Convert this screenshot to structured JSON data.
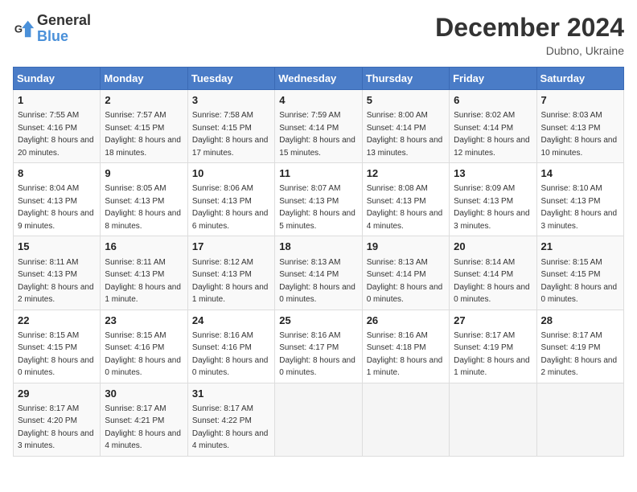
{
  "header": {
    "logo_general": "General",
    "logo_blue": "Blue",
    "month_title": "December 2024",
    "location": "Dubno, Ukraine"
  },
  "calendar": {
    "days_of_week": [
      "Sunday",
      "Monday",
      "Tuesday",
      "Wednesday",
      "Thursday",
      "Friday",
      "Saturday"
    ],
    "weeks": [
      [
        {
          "day": "1",
          "sunrise": "7:55 AM",
          "sunset": "4:16 PM",
          "daylight": "8 hours and 20 minutes."
        },
        {
          "day": "2",
          "sunrise": "7:57 AM",
          "sunset": "4:15 PM",
          "daylight": "8 hours and 18 minutes."
        },
        {
          "day": "3",
          "sunrise": "7:58 AM",
          "sunset": "4:15 PM",
          "daylight": "8 hours and 17 minutes."
        },
        {
          "day": "4",
          "sunrise": "7:59 AM",
          "sunset": "4:14 PM",
          "daylight": "8 hours and 15 minutes."
        },
        {
          "day": "5",
          "sunrise": "8:00 AM",
          "sunset": "4:14 PM",
          "daylight": "8 hours and 13 minutes."
        },
        {
          "day": "6",
          "sunrise": "8:02 AM",
          "sunset": "4:14 PM",
          "daylight": "8 hours and 12 minutes."
        },
        {
          "day": "7",
          "sunrise": "8:03 AM",
          "sunset": "4:13 PM",
          "daylight": "8 hours and 10 minutes."
        }
      ],
      [
        {
          "day": "8",
          "sunrise": "8:04 AM",
          "sunset": "4:13 PM",
          "daylight": "8 hours and 9 minutes."
        },
        {
          "day": "9",
          "sunrise": "8:05 AM",
          "sunset": "4:13 PM",
          "daylight": "8 hours and 8 minutes."
        },
        {
          "day": "10",
          "sunrise": "8:06 AM",
          "sunset": "4:13 PM",
          "daylight": "8 hours and 6 minutes."
        },
        {
          "day": "11",
          "sunrise": "8:07 AM",
          "sunset": "4:13 PM",
          "daylight": "8 hours and 5 minutes."
        },
        {
          "day": "12",
          "sunrise": "8:08 AM",
          "sunset": "4:13 PM",
          "daylight": "8 hours and 4 minutes."
        },
        {
          "day": "13",
          "sunrise": "8:09 AM",
          "sunset": "4:13 PM",
          "daylight": "8 hours and 3 minutes."
        },
        {
          "day": "14",
          "sunrise": "8:10 AM",
          "sunset": "4:13 PM",
          "daylight": "8 hours and 3 minutes."
        }
      ],
      [
        {
          "day": "15",
          "sunrise": "8:11 AM",
          "sunset": "4:13 PM",
          "daylight": "8 hours and 2 minutes."
        },
        {
          "day": "16",
          "sunrise": "8:11 AM",
          "sunset": "4:13 PM",
          "daylight": "8 hours and 1 minute."
        },
        {
          "day": "17",
          "sunrise": "8:12 AM",
          "sunset": "4:13 PM",
          "daylight": "8 hours and 1 minute."
        },
        {
          "day": "18",
          "sunrise": "8:13 AM",
          "sunset": "4:14 PM",
          "daylight": "8 hours and 0 minutes."
        },
        {
          "day": "19",
          "sunrise": "8:13 AM",
          "sunset": "4:14 PM",
          "daylight": "8 hours and 0 minutes."
        },
        {
          "day": "20",
          "sunrise": "8:14 AM",
          "sunset": "4:14 PM",
          "daylight": "8 hours and 0 minutes."
        },
        {
          "day": "21",
          "sunrise": "8:15 AM",
          "sunset": "4:15 PM",
          "daylight": "8 hours and 0 minutes."
        }
      ],
      [
        {
          "day": "22",
          "sunrise": "8:15 AM",
          "sunset": "4:15 PM",
          "daylight": "8 hours and 0 minutes."
        },
        {
          "day": "23",
          "sunrise": "8:15 AM",
          "sunset": "4:16 PM",
          "daylight": "8 hours and 0 minutes."
        },
        {
          "day": "24",
          "sunrise": "8:16 AM",
          "sunset": "4:16 PM",
          "daylight": "8 hours and 0 minutes."
        },
        {
          "day": "25",
          "sunrise": "8:16 AM",
          "sunset": "4:17 PM",
          "daylight": "8 hours and 0 minutes."
        },
        {
          "day": "26",
          "sunrise": "8:16 AM",
          "sunset": "4:18 PM",
          "daylight": "8 hours and 1 minute."
        },
        {
          "day": "27",
          "sunrise": "8:17 AM",
          "sunset": "4:19 PM",
          "daylight": "8 hours and 1 minute."
        },
        {
          "day": "28",
          "sunrise": "8:17 AM",
          "sunset": "4:19 PM",
          "daylight": "8 hours and 2 minutes."
        }
      ],
      [
        {
          "day": "29",
          "sunrise": "8:17 AM",
          "sunset": "4:20 PM",
          "daylight": "8 hours and 3 minutes."
        },
        {
          "day": "30",
          "sunrise": "8:17 AM",
          "sunset": "4:21 PM",
          "daylight": "8 hours and 4 minutes."
        },
        {
          "day": "31",
          "sunrise": "8:17 AM",
          "sunset": "4:22 PM",
          "daylight": "8 hours and 4 minutes."
        },
        null,
        null,
        null,
        null
      ]
    ],
    "labels": {
      "sunrise": "Sunrise:",
      "sunset": "Sunset:",
      "daylight": "Daylight:"
    }
  }
}
